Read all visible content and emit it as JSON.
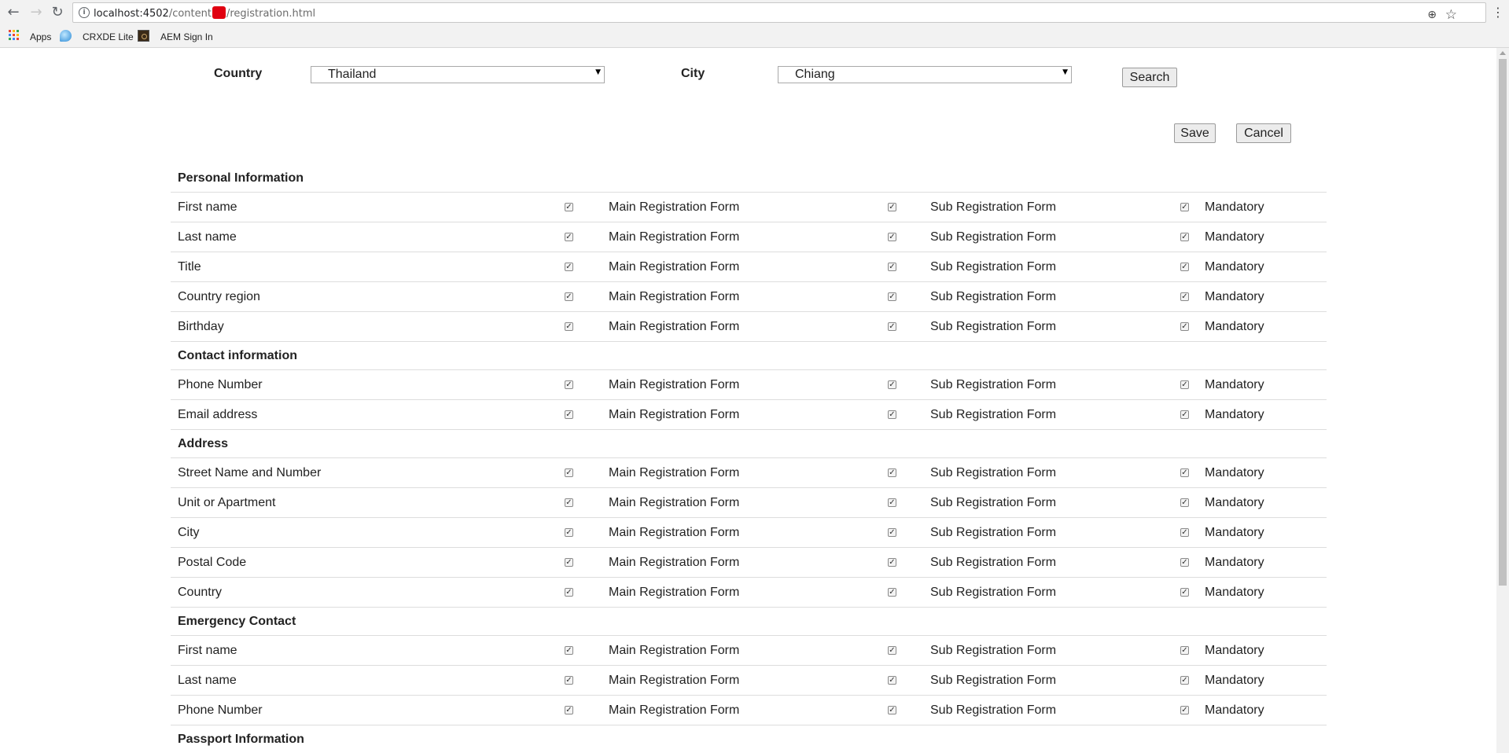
{
  "browser": {
    "url_host": "localhost:4502",
    "url_path_before": "/content",
    "url_path_after": "/registration.html",
    "bookmarks": [
      "Apps",
      "CRXDE Lite",
      "AEM Sign In"
    ]
  },
  "filters": {
    "country_label": "Country",
    "country_value": "Thailand",
    "city_label": "City",
    "city_value": "Chiang",
    "search_label": "Search"
  },
  "actions": {
    "save_label": "Save",
    "cancel_label": "Cancel"
  },
  "columns": {
    "main": "Main Registration Form",
    "sub": "Sub Registration Form",
    "mandatory": "Mandatory"
  },
  "sections": [
    {
      "title": "Personal Information",
      "fields": [
        "First name",
        "Last name",
        "Title",
        "Country region",
        "Birthday"
      ]
    },
    {
      "title": "Contact information",
      "fields": [
        "Phone Number",
        "Email address"
      ]
    },
    {
      "title": "Address",
      "fields": [
        "Street Name and Number",
        "Unit or Apartment",
        "City",
        "Postal Code",
        "Country"
      ]
    },
    {
      "title": "Emergency Contact",
      "fields": [
        "First name",
        "Last name",
        "Phone Number"
      ]
    },
    {
      "title": "Passport Information",
      "fields": []
    }
  ],
  "colors": {
    "chrome_bg": "#f2f2f2",
    "row_border": "#dddddd",
    "redaction": "#e00010"
  }
}
